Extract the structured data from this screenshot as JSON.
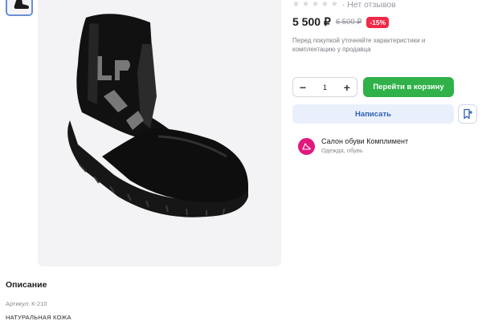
{
  "gallery": {
    "thumbnail_alt": "boot-thumbnail",
    "main_image": "black-leather-chelsea-boot"
  },
  "rating": {
    "stars_filled": 0,
    "stars_total": 5,
    "reviews_label": "· Нет отзывов"
  },
  "price": {
    "current": "5 500 ₽",
    "old": "6 500 ₽",
    "discount": "-15%"
  },
  "note": "Перед покупкой уточняйте характеристики и комплектацию у продавца",
  "quantity": {
    "minus": "−",
    "value": "1",
    "plus": "+"
  },
  "buttons": {
    "cart": "Перейти в корзину",
    "message": "Написать",
    "favorite_icon": "bookmark-plus-icon"
  },
  "seller": {
    "name": "Салон обуви Комплимент",
    "category": "Одежда, обувь"
  },
  "description": {
    "title": "Описание",
    "sku": "Артикул: К-210",
    "material": "НАТУРАЛЬНАЯ КОЖА"
  },
  "colors": {
    "accent_green": "#30b149",
    "discount_red": "#f02847",
    "link_blue": "#2f5fb8",
    "seller_pink": "#e0197d"
  }
}
